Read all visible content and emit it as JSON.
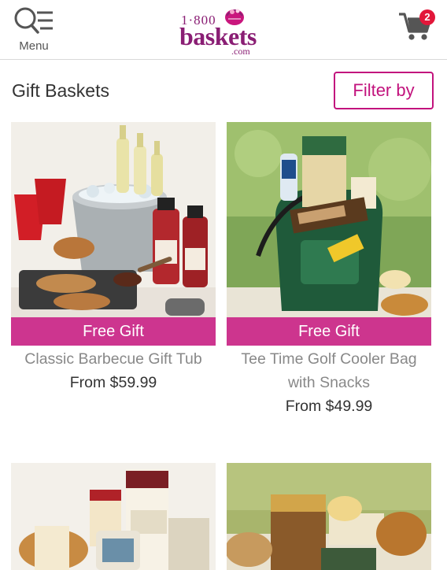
{
  "header": {
    "menu_label": "Menu",
    "logo_top": "1·800",
    "logo_main": "baskets",
    "logo_sub": ".com",
    "cart_count": "2"
  },
  "page": {
    "title": "Gift Baskets",
    "filter_label": "Filter by"
  },
  "products": [
    {
      "name": "Classic Barbecue Gift Tub",
      "price": "From $59.99",
      "badge": "Free Gift"
    },
    {
      "name": "Tee Time Golf Cooler Bag with Snacks",
      "price": "From $49.99",
      "badge": "Free Gift"
    },
    {
      "name": "",
      "price": "",
      "badge": ""
    },
    {
      "name": "",
      "price": "",
      "badge": ""
    }
  ],
  "colors": {
    "brand": "#8a1e74",
    "accent": "#c2137d",
    "badge": "#e2173a"
  },
  "icons": [
    "search-menu-icon",
    "basket-logo-icon",
    "cart-icon"
  ]
}
